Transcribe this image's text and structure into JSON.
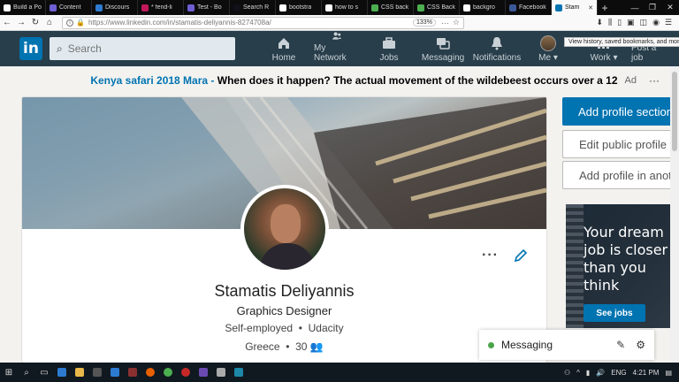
{
  "browser": {
    "tabs": [
      {
        "label": "Build a Portf",
        "color": "#ffffff"
      },
      {
        "label": "Content",
        "color": "#6e5fd3"
      },
      {
        "label": "Discours",
        "color": "#2d7bd1"
      },
      {
        "label": "* fend-li",
        "color": "#c2185b"
      },
      {
        "label": "Test - Bo",
        "color": "#6e5fd3"
      },
      {
        "label": "Search R",
        "color": "#101018"
      },
      {
        "label": "bootstra",
        "color": "#ffffff"
      },
      {
        "label": "how to s",
        "color": "#ffffff"
      },
      {
        "label": "CSS back",
        "color": "#4caf50"
      },
      {
        "label": "CSS Back",
        "color": "#4caf50"
      },
      {
        "label": "backgro",
        "color": "#ffffff"
      },
      {
        "label": "Facebook",
        "color": "#3b5998"
      },
      {
        "label": "Stam",
        "color": "#0073b1"
      }
    ],
    "url": "https://www.linkedin.com/in/stamatis-deliyannis-8274708a/",
    "zoom": "133%",
    "tooltip": "View history, saved bookmarks, and more"
  },
  "linkedin": {
    "search_placeholder": "Search",
    "nav": {
      "home": "Home",
      "network": "My Network",
      "jobs": "Jobs",
      "messaging": "Messaging",
      "notifications": "Notifications",
      "me": "Me",
      "work": "Work",
      "post_job": "Post a job"
    }
  },
  "ad": {
    "link": "Kenya safari 2018 Mara -",
    "text": "When does it happen? The actual movement of the wildebeest occurs over a 12",
    "tag": "Ad",
    "menu": "···"
  },
  "profile": {
    "name": "Stamatis Deliyannis",
    "headline": "Graphics Designer",
    "employment": "Self-employed",
    "school": "Udacity",
    "location": "Greece",
    "connections": "30"
  },
  "sidebar": {
    "add_section": "Add profile section",
    "edit_public": "Edit public profile &",
    "add_other_lang": "Add profile in anoth"
  },
  "jobs_ad": {
    "lines": [
      "Your dream",
      "job is closer",
      "than you",
      "think"
    ],
    "button": "See jobs"
  },
  "messaging": {
    "label": "Messaging"
  },
  "taskbar": {
    "lang": "ENG",
    "time": "4:21 PM"
  },
  "colors": {
    "brand": "#0073b1",
    "header_bg": "#283e4a"
  }
}
